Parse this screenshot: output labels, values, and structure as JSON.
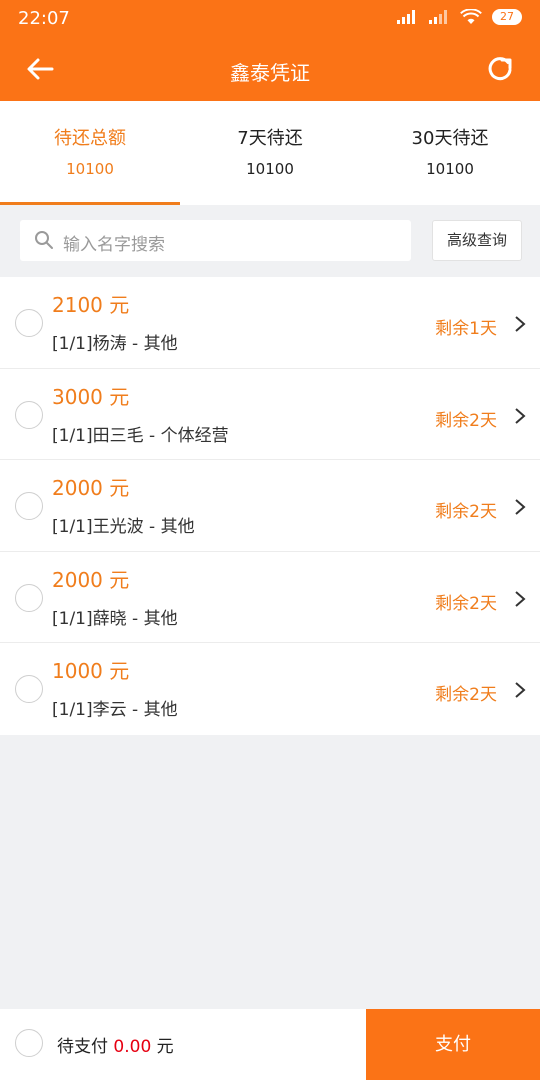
{
  "status": {
    "time": "22:07",
    "battery": "27"
  },
  "nav": {
    "title": "鑫泰凭证"
  },
  "tabs": [
    {
      "label": "待还总额",
      "value": "10100"
    },
    {
      "label": "7天待还",
      "value": "10100"
    },
    {
      "label": "30天待还",
      "value": "10100"
    }
  ],
  "search": {
    "placeholder": "输入名字搜索",
    "advanced_label": "高级查询"
  },
  "items": [
    {
      "amount": "2100 元",
      "desc": "[1/1]杨涛 - 其他",
      "remain": "剩余1天"
    },
    {
      "amount": "3000 元",
      "desc": "[1/1]田三毛 - 个体经营",
      "remain": "剩余2天"
    },
    {
      "amount": "2000 元",
      "desc": "[1/1]王光波 - 其他",
      "remain": "剩余2天"
    },
    {
      "amount": "2000 元",
      "desc": "[1/1]薛晓 - 其他",
      "remain": "剩余2天"
    },
    {
      "amount": "1000 元",
      "desc": "[1/1]李云 - 其他",
      "remain": "剩余2天"
    }
  ],
  "bottom": {
    "pending_label": "待支付",
    "pending_amount": "0.00",
    "unit": "元",
    "pay_label": "支付"
  },
  "colors": {
    "brand": "#fb7316",
    "accent": "#f07d1c",
    "amount_red": "#e60012"
  }
}
